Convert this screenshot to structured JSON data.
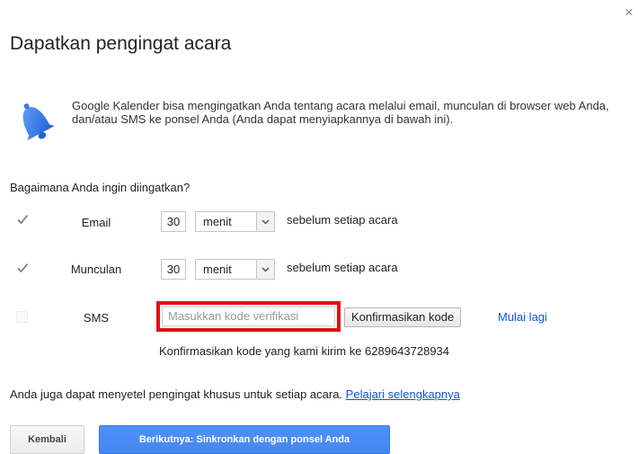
{
  "dialog": {
    "title": "Dapatkan pengingat acara",
    "close_glyph": "×",
    "intro": "Google Kalender bisa mengingatkan Anda tentang acara melalui email, munculan di browser web Anda, dan/atau SMS ke ponsel Anda (Anda dapat menyiapkannya di bawah ini).",
    "question": "Bagaimana Anda ingin diingatkan?",
    "icon": "bell-icon",
    "accent_color": "#4d90fe",
    "highlight_color": "#e21010"
  },
  "reminders": {
    "email": {
      "checked": true,
      "label": "Email",
      "value": "30",
      "unit": "menit",
      "after": "sebelum setiap acara"
    },
    "popup": {
      "checked": true,
      "label": "Munculan",
      "value": "30",
      "unit": "menit",
      "after": "sebelum setiap acara"
    },
    "sms": {
      "checked": false,
      "label": "SMS",
      "placeholder": "Masukkan kode verifikasi",
      "confirm_label": "Konfirmasikan kode",
      "restart_label": "Mulai lagi",
      "hint": "Konfirmasikan kode yang kami kirim ke 6289643728934"
    }
  },
  "footnote": {
    "text": "Anda juga dapat menyetel pengingat khusus untuk setiap acara.",
    "link": "Pelajari selengkapnya"
  },
  "buttons": {
    "back": "Kembali",
    "next": "Berikutnya: Sinkronkan dengan ponsel Anda"
  }
}
